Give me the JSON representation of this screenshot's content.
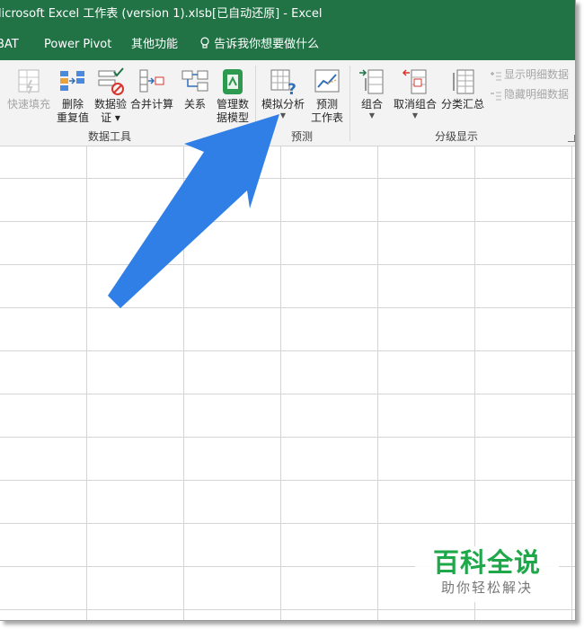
{
  "window": {
    "title": "licrosoft Excel 工作表 (version 1).xlsb[已自动还原]  -  Excel"
  },
  "menubar": {
    "items": [
      "BAT",
      "Power Pivot",
      "其他功能"
    ],
    "tell_me": "告诉我你想要做什么"
  },
  "ribbon": {
    "data_tools": {
      "label": "数据工具",
      "flash_fill": "快速填充",
      "remove_dup_1": "删除",
      "remove_dup_2": "重复值",
      "validation_1": "数据验",
      "validation_2": "证",
      "consolidate": "合并计算",
      "relationships": "关系",
      "manage_model_1": "管理数",
      "manage_model_2": "据模型"
    },
    "forecast": {
      "label": "预测",
      "what_if": "模拟分析",
      "forecast_sheet_1": "预测",
      "forecast_sheet_2": "工作表"
    },
    "outline": {
      "label": "分级显示",
      "group": "组合",
      "ungroup": "取消组合",
      "subtotal": "分类汇总",
      "show_detail": "显示明细数据",
      "hide_detail": "隐藏明细数据"
    }
  },
  "watermark": {
    "title": "百科全说",
    "subtitle": "助你轻松解决"
  },
  "colors": {
    "excel_green": "#217346",
    "arrow_blue": "#2f7fe6",
    "watermark_green": "#1ea84a"
  }
}
